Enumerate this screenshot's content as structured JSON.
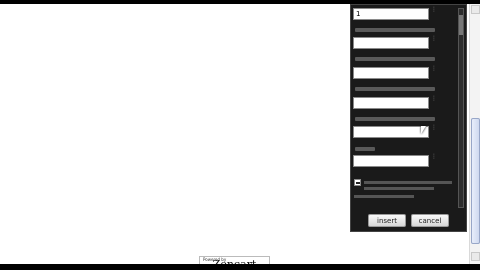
{
  "panel": {
    "fields": [
      {
        "value": "1"
      },
      {
        "value": ""
      },
      {
        "value": ""
      },
      {
        "value": ""
      },
      {
        "value": ""
      },
      {
        "value": ""
      }
    ],
    "buttons": {
      "insert": "insert",
      "cancel": "cancel"
    }
  },
  "footer": {
    "logo_text": "Zencart",
    "logo_tagline": "Powered by"
  }
}
